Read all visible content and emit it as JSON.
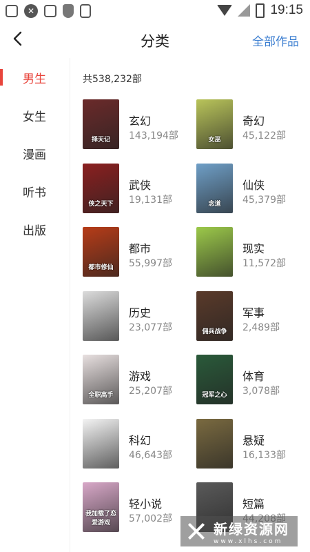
{
  "status_bar": {
    "time": "19:15",
    "left_icons": [
      "cup-icon",
      "close-circle-icon",
      "bug-icon",
      "shield-icon",
      "toggle-icon"
    ],
    "right_icons": [
      "wifi-icon",
      "no-signal-icon",
      "battery-charging-icon"
    ]
  },
  "header": {
    "title": "分类",
    "right_link": "全部作品"
  },
  "sidebar": {
    "items": [
      {
        "label": "男生",
        "active": true
      },
      {
        "label": "女生"
      },
      {
        "label": "漫画"
      },
      {
        "label": "听书"
      },
      {
        "label": "出版"
      }
    ]
  },
  "main": {
    "total": "共538,232部",
    "categories": [
      {
        "name": "玄幻",
        "count": "143,194部",
        "cover_text": "择天记",
        "cover_color": "#6b2a2a"
      },
      {
        "name": "奇幻",
        "count": "45,122部",
        "cover_text": "女巫",
        "cover_color": "#b9c45a"
      },
      {
        "name": "武侠",
        "count": "19,131部",
        "cover_text": "侠之天下",
        "cover_color": "#8b2020"
      },
      {
        "name": "仙侠",
        "count": "45,379部",
        "cover_text": "念道",
        "cover_color": "#6f9fc7"
      },
      {
        "name": "都市",
        "count": "55,997部",
        "cover_text": "都市修仙",
        "cover_color": "#b73c18"
      },
      {
        "name": "现实",
        "count": "11,572部",
        "cover_text": "",
        "cover_color": "#9cc94a"
      },
      {
        "name": "历史",
        "count": "23,077部",
        "cover_text": "",
        "cover_color": "#dcdcdc"
      },
      {
        "name": "军事",
        "count": "2,489部",
        "cover_text": "佣兵战争",
        "cover_color": "#5a3a2a"
      },
      {
        "name": "游戏",
        "count": "25,207部",
        "cover_text": "全职高手",
        "cover_color": "#e8e0e0"
      },
      {
        "name": "体育",
        "count": "3,078部",
        "cover_text": "冠军之心",
        "cover_color": "#2a5a3a"
      },
      {
        "name": "科幻",
        "count": "46,643部",
        "cover_text": "",
        "cover_color": "#f4f4f4"
      },
      {
        "name": "悬疑",
        "count": "16,133部",
        "cover_text": "",
        "cover_color": "#7a6a40"
      },
      {
        "name": "轻小说",
        "count": "57,002部",
        "cover_text": "我加载了恋爱游戏",
        "cover_color": "#d8a8c8"
      },
      {
        "name": "短篇",
        "count": "44,208部",
        "cover_text": "",
        "cover_color": "#5a5a5a"
      }
    ]
  },
  "watermark": {
    "title": "新绿资源网",
    "subtitle": "www.xlhs.com"
  }
}
